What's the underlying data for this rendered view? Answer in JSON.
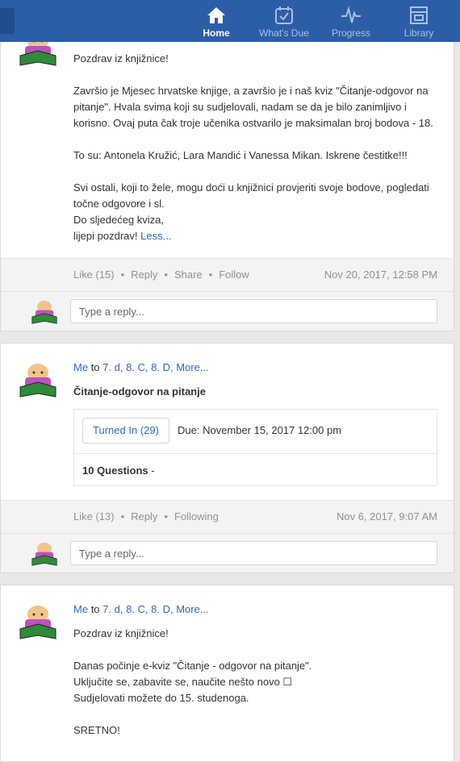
{
  "nav": {
    "items": [
      {
        "label": "Home",
        "icon": "home-icon"
      },
      {
        "label": "What's Due",
        "icon": "calendar-check-icon"
      },
      {
        "label": "Progress",
        "icon": "pulse-icon"
      },
      {
        "label": "Library",
        "icon": "library-icon"
      }
    ]
  },
  "post1": {
    "greeting": "Pozdrav iz knjižnice!",
    "para1": "Završio je Mjesec hrvatske knjige, a završio je i naš kviz \"Čitanje-odgovor na pitanje\". Hvala svima koji su sudjelovali, nadam se da je bilo zanimljivo i korisno. Ovaj puta čak troje učenika ostvarilo je maksimalan broj bodova - 18.",
    "para2": "To su: Antonela Kružić, Lara Mandić i Vanessa Mikan. Iskrene čestitke!!!",
    "para3_line1": "Svi ostali, koji to žele, mogu doći u knjižnici provjeriti svoje bodove, pogledati točne odgovore i sl.",
    "para3_line2": "Do sljedećeg kviza,",
    "para3_line3": "lijepi pozdrav!",
    "less": "Less...",
    "like": "Like (15)",
    "reply": "Reply",
    "share": "Share",
    "follow": "Follow",
    "date": "Nov 20, 2017, 12:58 PM",
    "reply_placeholder": "Type a reply..."
  },
  "post2": {
    "sender": "Me",
    "to": "to",
    "recipients": "7. d, 8. C, 8. D, More...",
    "title": "Čitanje-odgovor na pitanje",
    "turned_in": "Turned In (29)",
    "due": "Due: November 15, 2017 12:00 pm",
    "questions": "10 Questions",
    "questions_suffix": " -",
    "like": "Like (13)",
    "reply": "Reply",
    "following": "Following",
    "date": "Nov 6, 2017, 9:07 AM",
    "reply_placeholder": "Type a reply..."
  },
  "post3": {
    "sender": "Me",
    "to": "to",
    "recipients": "7. d, 8. C, 8. D, More...",
    "greeting": "Pozdrav iz knjižnice!",
    "line1": "Danas počinje e-kviz \"Čitanje - odgovor na pitanje\".",
    "line2": "Uključite se, zabavite se, naučite nešto novo ☐",
    "line3": "Sudjelovati možete do 15. studenoga.",
    "line4": "SRETNO!"
  }
}
